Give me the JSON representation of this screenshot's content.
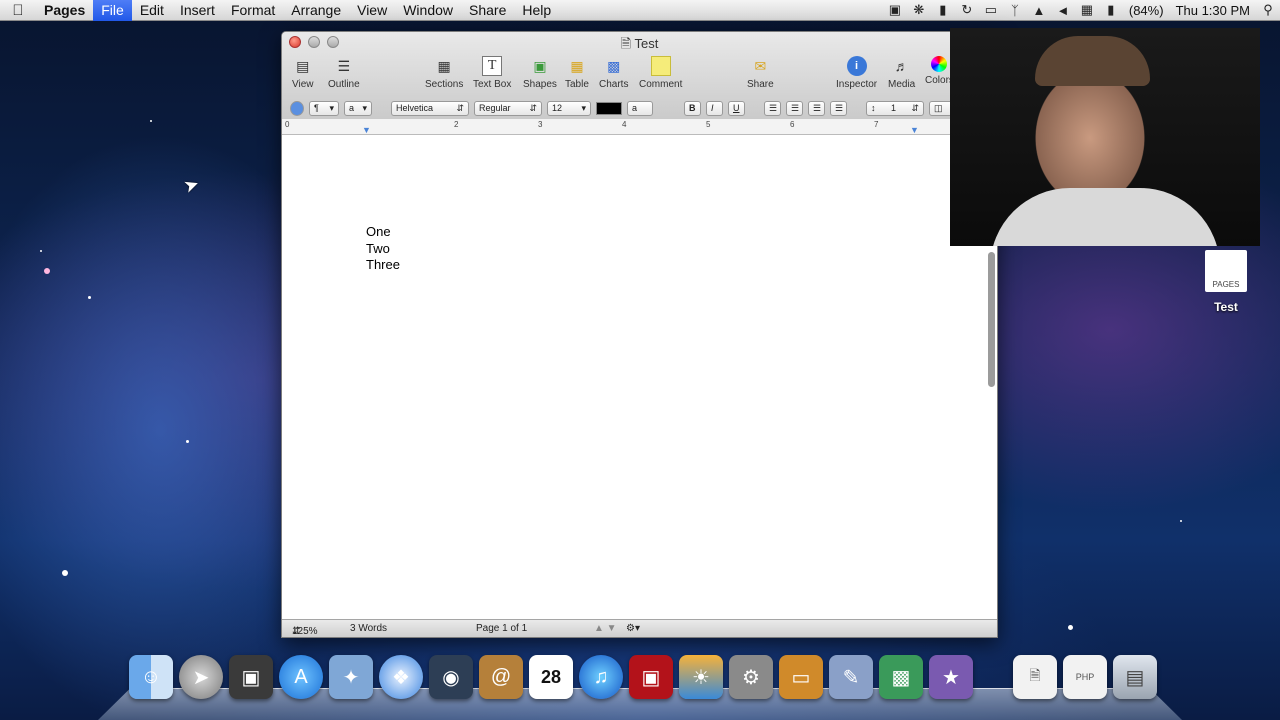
{
  "menubar": {
    "apple_icon": "apple-icon",
    "items": [
      "Pages",
      "File",
      "Edit",
      "Insert",
      "Format",
      "Arrange",
      "View",
      "Window",
      "Share",
      "Help"
    ],
    "active_item": "File",
    "battery": "(84%)",
    "clock": "Thu 1:30 PM",
    "status_icons": [
      "camera-icon",
      "sync-icon",
      "lock-icon",
      "refresh-icon",
      "display-icon",
      "bluetooth-icon",
      "wifi-icon",
      "volume-icon",
      "keyboard-icon",
      "battery-icon"
    ]
  },
  "window": {
    "title": "Test",
    "toolbar": {
      "view": "View",
      "outline": "Outline",
      "sections": "Sections",
      "text_box": "Text Box",
      "shapes": "Shapes",
      "table": "Table",
      "charts": "Charts",
      "comment": "Comment",
      "share": "Share",
      "inspector": "Inspector",
      "media": "Media",
      "colors": "Colors"
    },
    "format_bar": {
      "paragraph_style": "¶",
      "char_style": "a",
      "font": "Helvetica",
      "typeface": "Regular",
      "size": "12",
      "bold": "B",
      "italic": "I",
      "underline": "U",
      "line_spacing": "1"
    },
    "ruler_numbers": [
      "0",
      "2",
      "3",
      "4",
      "5",
      "6",
      "7"
    ],
    "document_lines": [
      "One",
      "Two",
      "Three"
    ],
    "status": {
      "zoom": "125%",
      "word_count": "3 Words",
      "page": "Page 1 of 1"
    }
  },
  "desktop": {
    "file_label": "Test",
    "file_type": "PAGES"
  },
  "dock": {
    "items": [
      "finder-icon",
      "launchpad-icon",
      "image-capture-icon",
      "app-store-icon",
      "preview-icon",
      "safari-icon",
      "facetime-icon",
      "address-book-icon",
      "ical-icon",
      "itunes-icon",
      "photo-booth-icon",
      "iphoto-icon",
      "system-preferences-icon",
      "keynote-icon",
      "pages-icon",
      "numbers-icon",
      "imovie-icon",
      "documents-icon",
      "php-file-icon",
      "trash-icon"
    ],
    "calendar_day": "28"
  }
}
